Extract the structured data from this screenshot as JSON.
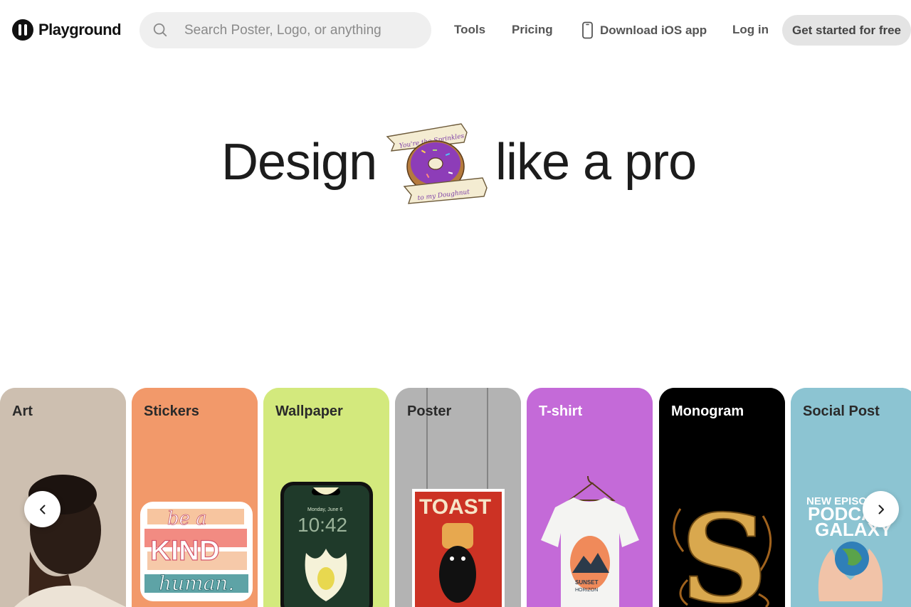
{
  "brand": {
    "name": "Playground"
  },
  "search": {
    "placeholder": "Search Poster, Logo, or anything",
    "icon": "search-icon"
  },
  "nav": {
    "tools": "Tools",
    "pricing": "Pricing",
    "ios_app": "Download iOS app",
    "login": "Log in",
    "cta": "Get started for free"
  },
  "hero": {
    "left": "Design",
    "right": "like a pro",
    "sticker_text_top": "You're the Sprinkles",
    "sticker_text_bottom": "to my Doughnut"
  },
  "cards": [
    {
      "label": "Art",
      "bg": "#cdbfb0",
      "label_color": "#2a2a2a"
    },
    {
      "label": "Stickers",
      "bg": "#f2996a",
      "label_color": "#2a2a2a",
      "art_text": [
        "be a",
        "KIND",
        "human."
      ]
    },
    {
      "label": "Wallpaper",
      "bg": "#d3e97d",
      "label_color": "#2a2a2a",
      "art_text": [
        "Monday, June 6",
        "10:42"
      ]
    },
    {
      "label": "Poster",
      "bg": "#b3b3b3",
      "label_color": "#2a2a2a",
      "art_text": [
        "TOAST"
      ]
    },
    {
      "label": "T-shirt",
      "bg": "#c46ad8",
      "label_color": "#ffffff",
      "art_text": [
        "SUNSET",
        "HORIZON"
      ]
    },
    {
      "label": "Monogram",
      "bg": "#000000",
      "label_color": "#ffffff",
      "art_text": [
        "S"
      ]
    },
    {
      "label": "Social Post",
      "bg": "#8cc4d2",
      "label_color": "#2a2a2a",
      "art_text": [
        "NEW EPISODE",
        "PODCAST",
        "GALAXY"
      ]
    }
  ],
  "carousel": {
    "prev_icon": "chevron-left-icon",
    "next_icon": "chevron-right-icon"
  }
}
